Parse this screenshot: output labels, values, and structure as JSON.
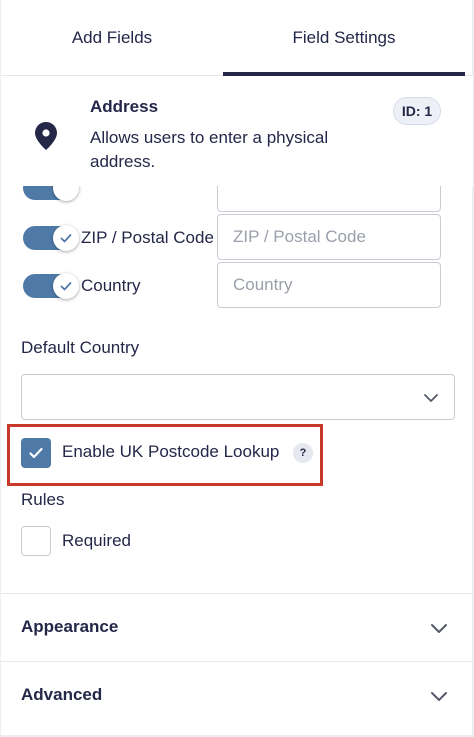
{
  "tabs": {
    "add_fields": "Add Fields",
    "field_settings": "Field Settings"
  },
  "field": {
    "title": "Address",
    "description": "Allows users to enter a physical address.",
    "id_badge": "ID: 1"
  },
  "subfields": [
    {
      "label": "ZIP / Postal Code",
      "placeholder": "ZIP / Postal Code",
      "enabled": true
    },
    {
      "label": "Country",
      "placeholder": "Country",
      "enabled": true
    }
  ],
  "default_country": {
    "label": "Default Country",
    "value": ""
  },
  "uk_lookup": {
    "label": "Enable UK Postcode Lookup",
    "help": "?",
    "checked": true
  },
  "rules": {
    "label": "Rules",
    "required_label": "Required",
    "required_checked": false
  },
  "accordions": {
    "appearance": "Appearance",
    "advanced": "Advanced"
  },
  "colors": {
    "accent": "#4f7aa7",
    "text": "#242748",
    "highlight": "#c73a2a"
  }
}
